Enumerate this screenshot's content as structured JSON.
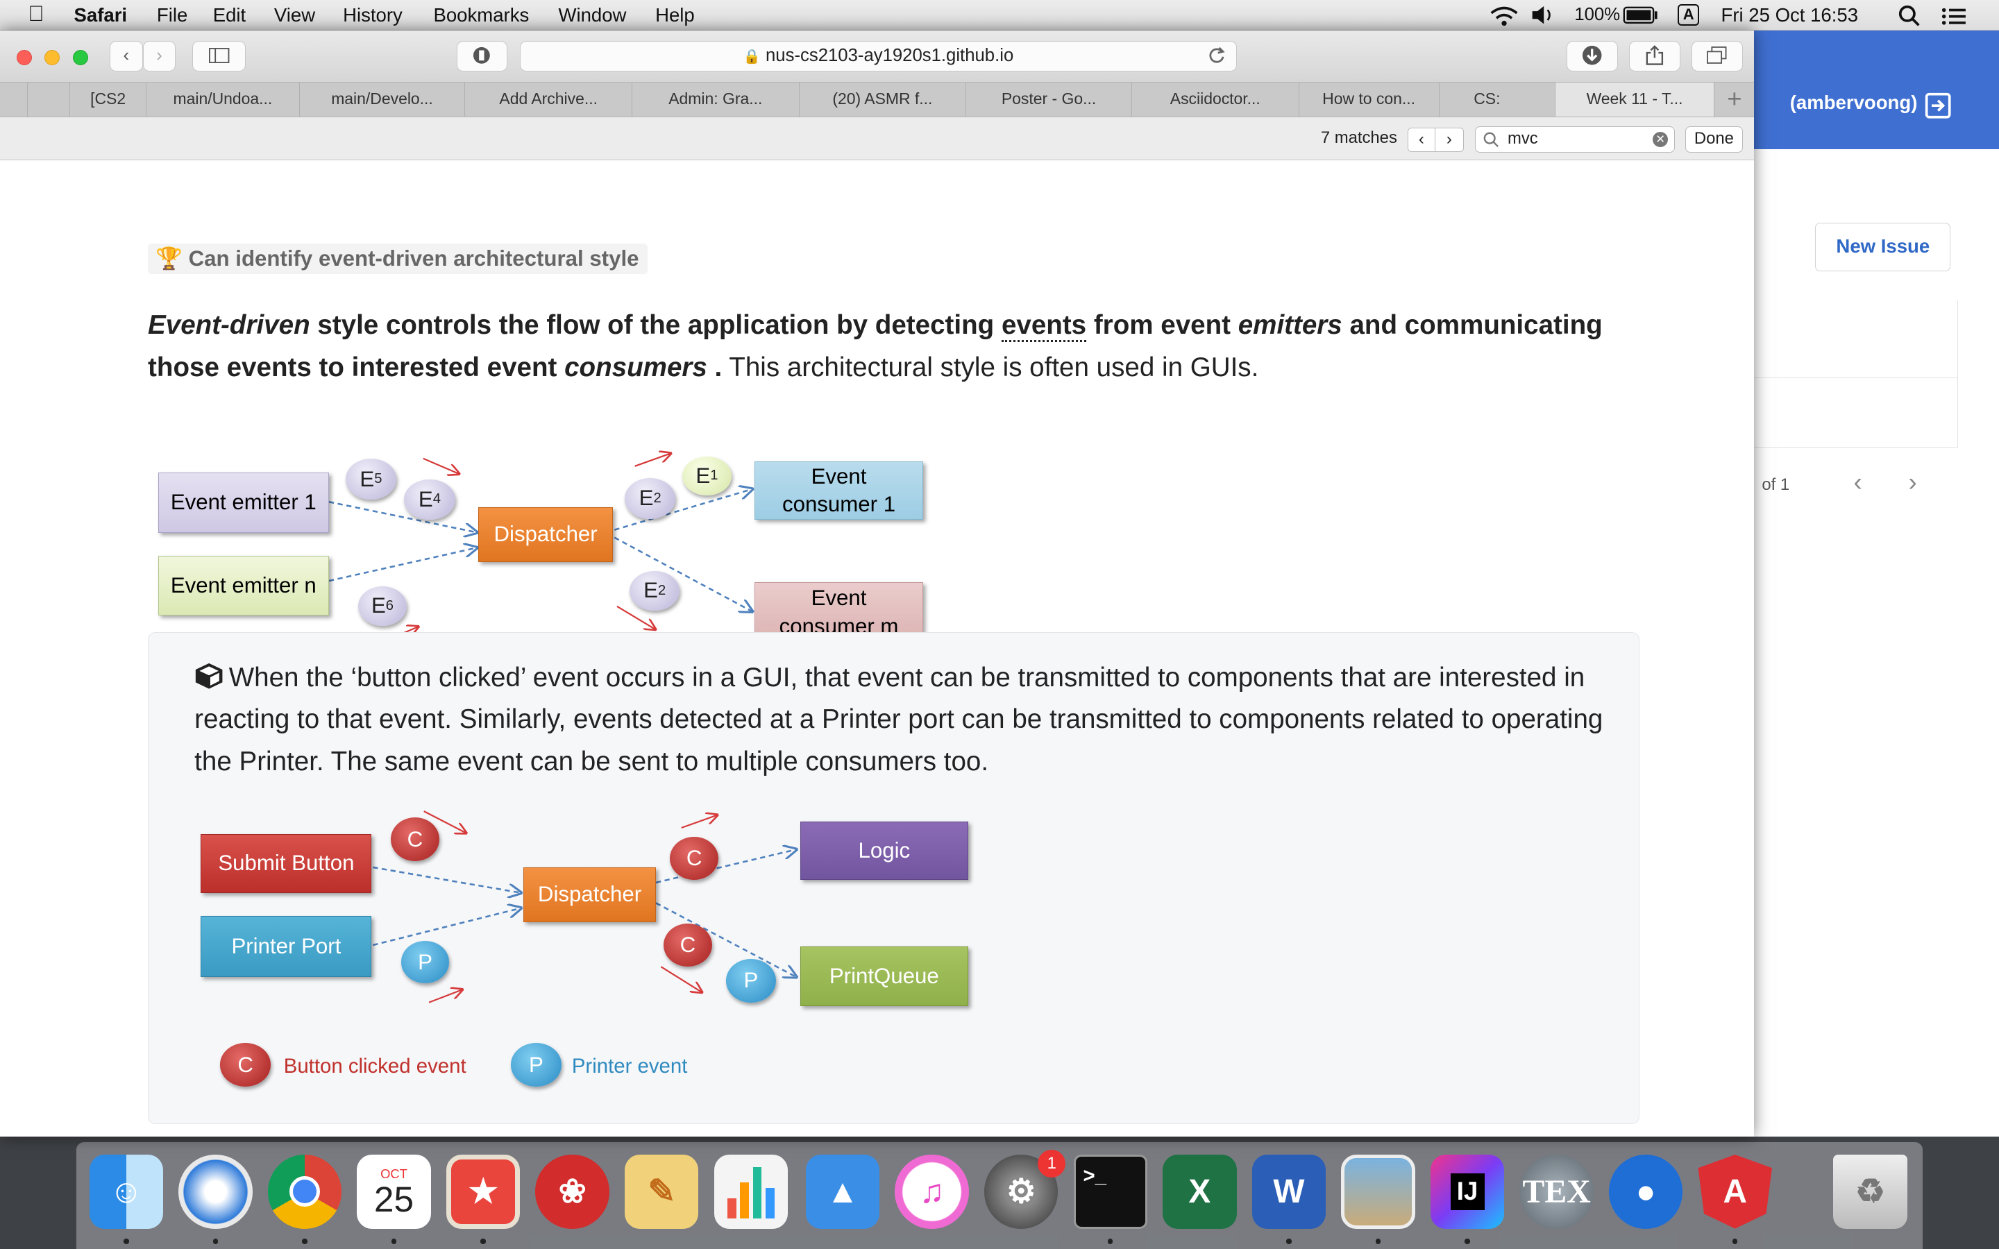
{
  "menubar": {
    "app": "Safari",
    "items": [
      "File",
      "Edit",
      "View",
      "History",
      "Bookmarks",
      "Window",
      "Help"
    ],
    "battery": "100%",
    "input_source": "A",
    "datetime": "Fri 25 Oct  16:53"
  },
  "browser": {
    "url": "nus-cs2103-ay1920s1.github.io",
    "tabs": [
      "[CS2",
      "main/Undoa...",
      "main/Develo...",
      "Add Archive...",
      "Admin: Gra...",
      "(20) ASMR f...",
      "Poster - Go...",
      "Asciidoctor...",
      "How to con...",
      "CS:",
      "Week 11 - T..."
    ],
    "active_tab_index": 10,
    "find": {
      "matches": "7 matches",
      "query": "mvc",
      "done_label": "Done"
    }
  },
  "background_window": {
    "user": "(ambervoong)",
    "new_issue_label": "New Issue",
    "pager": "of 1"
  },
  "content": {
    "outcome": "Can identify event-driven architectural style",
    "intro": {
      "t1": "Event-driven",
      "t2": " style controls the flow of the application by detecting ",
      "t3": "events",
      "t4": " from event ",
      "t5": "emitters",
      "t6": " and communicating those events to interested event ",
      "t7": "consumers",
      "t8": " .",
      "t9": " This architectural style is often used in GUIs."
    },
    "diagram1": {
      "emitter1": "Event emitter 1",
      "emittern": "Event emitter n",
      "dispatcher": "Dispatcher",
      "consumer1": "Event consumer 1",
      "consumerm": "Event consumer m",
      "bubbles": {
        "e5": "E",
        "e5_sub": "5",
        "e4": "E",
        "e4_sub": "4",
        "e6": "E",
        "e6_sub": "6",
        "e2a": "E",
        "e2a_sub": "2",
        "e1": "E",
        "e1_sub": "1",
        "e2b": "E",
        "e2b_sub": "2"
      }
    },
    "example": {
      "text": "When the ‘button clicked’ event occurs in a GUI, that event can be transmitted to components that are interested in reacting to that event. Similarly, events detected at a Printer port can be transmitted to components related to operating the Printer. The same event can be sent to multiple consumers too."
    },
    "diagram2": {
      "submit": "Submit Button",
      "printer": "Printer Port",
      "dispatcher": "Dispatcher",
      "logic": "Logic",
      "printqueue": "PrintQueue",
      "c": "C",
      "p": "P",
      "legend_c": "Button clicked event",
      "legend_p": "Printer event"
    }
  },
  "dock": {
    "calendar_month": "OCT",
    "calendar_day": "25",
    "badge": "1"
  }
}
